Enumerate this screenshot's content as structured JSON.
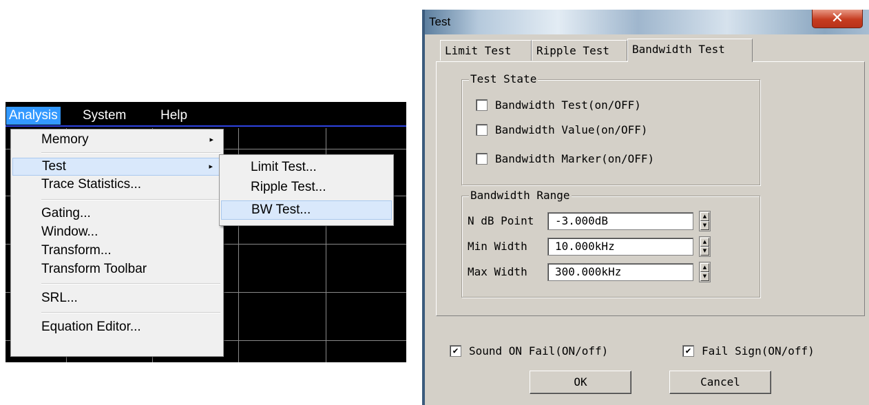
{
  "menubar": {
    "items": [
      "Analysis",
      "System",
      "Help"
    ],
    "active": "Analysis",
    "highlight_color": "#3399ff"
  },
  "analysis_menu": {
    "items": [
      {
        "label": "Memory",
        "has_submenu": true
      },
      {
        "label": "Test",
        "has_submenu": true,
        "highlighted": true
      },
      {
        "label": "Trace Statistics..."
      },
      {
        "label": "Gating..."
      },
      {
        "label": "Window..."
      },
      {
        "label": "Transform..."
      },
      {
        "label": "Transform Toolbar"
      },
      {
        "label": "SRL..."
      },
      {
        "label": "Equation Editor..."
      }
    ],
    "submenu_arrow": "▸"
  },
  "test_submenu": {
    "items": [
      {
        "label": "Limit Test..."
      },
      {
        "label": "Ripple Test..."
      },
      {
        "label": "BW Test...",
        "highlighted": true
      }
    ]
  },
  "dialog": {
    "title": "Test",
    "close_glyph": "✕",
    "tabs": [
      "Limit Test",
      "Ripple Test",
      "Bandwidth Test"
    ],
    "active_tab": "Bandwidth Test",
    "test_state": {
      "title": "Test State",
      "checkboxes": [
        {
          "label": "Bandwidth Test(on/OFF)",
          "checked": false
        },
        {
          "label": "Bandwidth Value(on/OFF)",
          "checked": false
        },
        {
          "label": "Bandwidth Marker(on/OFF)",
          "checked": false
        }
      ]
    },
    "bandwidth_range": {
      "title": "Bandwidth Range",
      "fields": [
        {
          "label": "N dB Point",
          "value": "-3.000dB"
        },
        {
          "label": "Min Width",
          "value": "10.000kHz"
        },
        {
          "label": "Max Width",
          "value": "300.000kHz"
        }
      ]
    },
    "bottom": {
      "sound_on_fail": {
        "label": "Sound ON Fail(ON/off)",
        "checked": true
      },
      "fail_sign": {
        "label": "Fail Sign(ON/off)",
        "checked": true
      }
    },
    "buttons": {
      "ok": "OK",
      "cancel": "Cancel"
    },
    "check_glyph": "✔",
    "spin_up_glyph": "▲",
    "spin_down_glyph": "▼"
  }
}
